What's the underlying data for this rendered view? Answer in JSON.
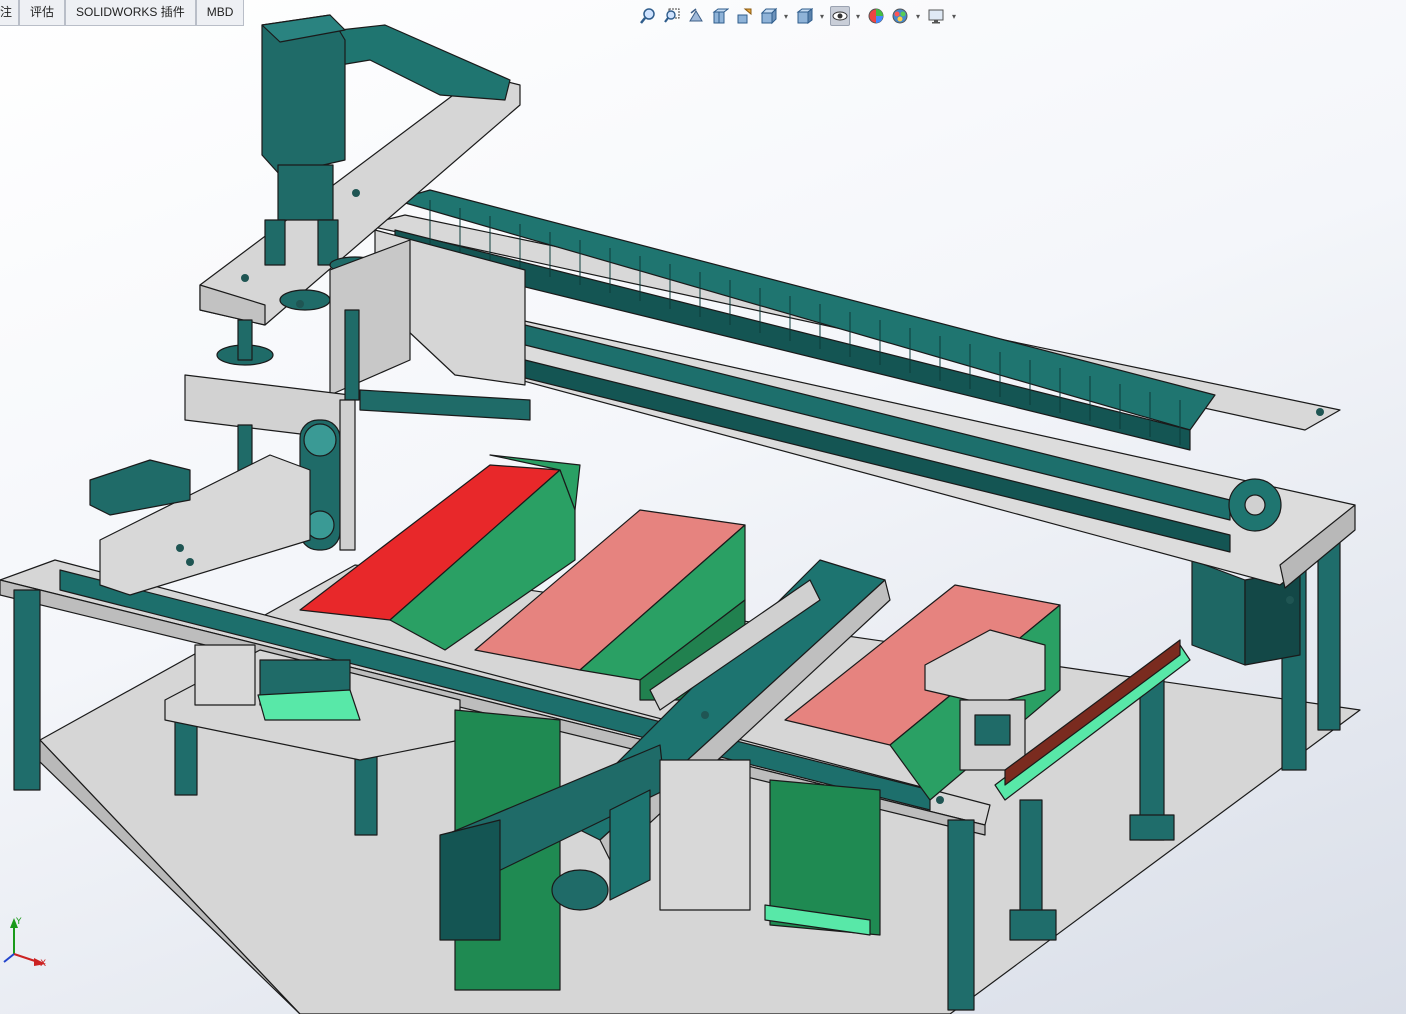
{
  "command_manager": {
    "tabs": [
      {
        "label": "标注",
        "visible": "注"
      },
      {
        "label": "评估"
      },
      {
        "label": "SOLIDWORKS 插件"
      },
      {
        "label": "MBD"
      }
    ]
  },
  "heads_up_toolbar": {
    "buttons": [
      {
        "name": "zoom-to-fit-icon"
      },
      {
        "name": "zoom-to-area-icon"
      },
      {
        "name": "previous-view-icon"
      },
      {
        "name": "section-view-icon"
      },
      {
        "name": "dynamic-annotation-icon"
      },
      {
        "name": "view-orientation-icon"
      },
      {
        "name": "display-style-icon"
      },
      {
        "name": "hide-show-items-icon"
      },
      {
        "name": "edit-appearance-icon"
      },
      {
        "name": "apply-scene-icon"
      },
      {
        "name": "view-settings-icon"
      }
    ]
  },
  "triad": {
    "x_label": "X",
    "y_label": "Y"
  },
  "colors": {
    "teal": "#1d6f6c",
    "teal_dark": "#0f4a48",
    "grey_plate": "#d8d8d8",
    "green": "#2aa064",
    "red": "#e8282a",
    "salmon": "#e6837f",
    "mint": "#58e8a8"
  }
}
